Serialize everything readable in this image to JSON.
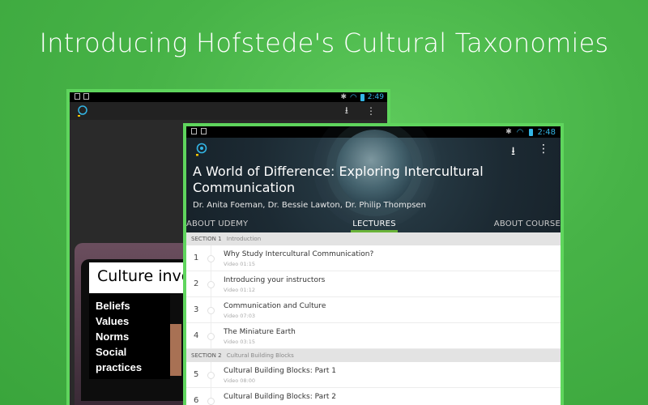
{
  "headline": "Introducing Hofstede's Cultural Taxonomies",
  "back_screen": {
    "status_time": "2:49",
    "slide": {
      "title": "Culture invo",
      "items": [
        "Beliefs",
        "Values",
        "Norms",
        "Social practices"
      ]
    }
  },
  "front_screen": {
    "status_time": "2:48",
    "course_title": "A World of Difference: Exploring Intercultural Communication",
    "authors": "Dr.  Anita Foeman, Dr. Bessie Lawton, Dr. Philip Thompsen",
    "tabs": {
      "about_udemy": "ABOUT UDEMY",
      "lectures": "LECTURES",
      "about_course": "ABOUT COURSE"
    },
    "section1": {
      "label": "SECTION 1",
      "name": "Introduction"
    },
    "section2": {
      "label": "SECTION 2",
      "name": "Cultural Building Blocks"
    },
    "lectures_s1": [
      {
        "num": "1",
        "title": "Why Study Intercultural Communication?",
        "meta": "Video 01:15"
      },
      {
        "num": "2",
        "title": "Introducing your instructors",
        "meta": "Video 01:12"
      },
      {
        "num": "3",
        "title": "Communication and Culture",
        "meta": "Video 07:03"
      },
      {
        "num": "4",
        "title": "The Miniature Earth",
        "meta": "Video 03:15"
      }
    ],
    "lectures_s2": [
      {
        "num": "5",
        "title": "Cultural Building Blocks: Part 1",
        "meta": "Video 08:00"
      },
      {
        "num": "6",
        "title": "Cultural Building Blocks: Part 2",
        "meta": ""
      }
    ]
  },
  "colors": {
    "background": "#47b347",
    "tablet_border": "#5fd55d",
    "tab_indicator": "#6ab43a",
    "status_blue": "#33b5e5"
  },
  "icons": {
    "download": "download-icon",
    "overflow": "overflow-menu-icon",
    "logo": "udemy-logo-icon"
  }
}
